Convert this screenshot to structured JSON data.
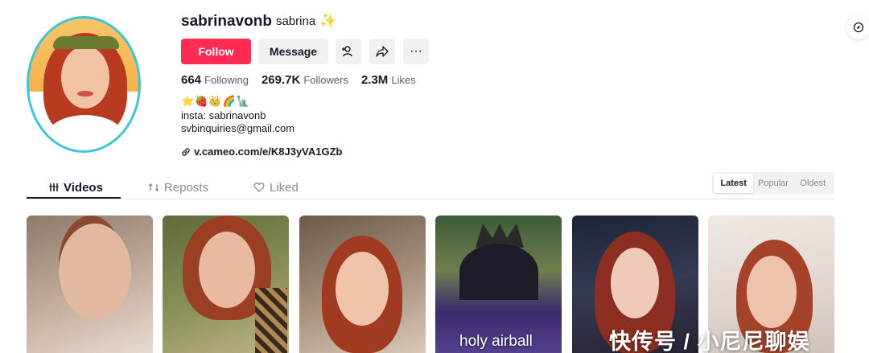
{
  "profile": {
    "username": "sabrinavonb",
    "nickname": "sabrina",
    "nickname_icon": "sparkle-icon"
  },
  "actions": {
    "follow_label": "Follow",
    "message_label": "Message",
    "add_friend_icon": "add-user-icon",
    "share_icon": "share-icon",
    "more_icon": "more-icon",
    "more_glyph": "···"
  },
  "stats": {
    "following_count": "664",
    "following_label": "Following",
    "followers_count": "269.7K",
    "followers_label": "Followers",
    "likes_count": "2.3M",
    "likes_label": "Likes"
  },
  "bio": {
    "emoji_line": "⭐🍓👑🌈🗽",
    "line1": "insta: sabrinavonb",
    "line2": "svbinquiries@gmail.com",
    "link": "v.cameo.com/e/K8J3yVA1GZb"
  },
  "tabs": [
    {
      "label": "Videos",
      "icon": "grid-icon",
      "active": true
    },
    {
      "label": "Reposts",
      "icon": "repost-icon",
      "active": false
    },
    {
      "label": "Liked",
      "icon": "heart-icon",
      "active": false
    }
  ],
  "sort": {
    "options": [
      "Latest",
      "Popular",
      "Oldest"
    ],
    "selected": "Latest"
  },
  "videos": [
    {
      "caption": ""
    },
    {
      "caption": ""
    },
    {
      "caption": ""
    },
    {
      "caption": "holy airball"
    },
    {
      "caption": ""
    },
    {
      "caption": ""
    }
  ],
  "watermark": "快传号 / 小尼尼聊娱",
  "colors": {
    "accent": "#fe2c55",
    "avatar_ring": "#3fc5d6"
  }
}
